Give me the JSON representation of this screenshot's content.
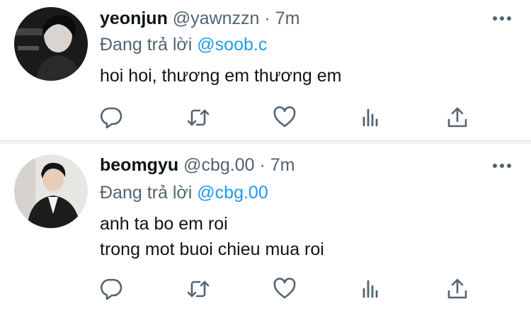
{
  "tweets": [
    {
      "name": "yeonjun",
      "handle": "@yawnzzn",
      "separator": "·",
      "time": "7m",
      "reply_prefix": "Đang trả lời",
      "reply_to": "@soob.c",
      "lines": [
        "hoi hoi, thương em thương em"
      ]
    },
    {
      "name": "beomgyu",
      "handle": "@cbg.00",
      "separator": "·",
      "time": "7m",
      "reply_prefix": "Đang trả lời",
      "reply_to": "@cbg.00",
      "lines": [
        "anh ta bo em roi",
        "trong mot buoi chieu mua roi"
      ]
    }
  ],
  "icons": {
    "more": "more-dots-icon",
    "reply": "reply-bubble-icon",
    "retweet": "retweet-icon",
    "like": "heart-icon",
    "analytics": "analytics-bars-icon",
    "share": "share-upload-icon"
  },
  "colors": {
    "name": "#0f1419",
    "secondary": "#536471",
    "mention": "#1d9bf0",
    "divider": "#eff3f4"
  }
}
